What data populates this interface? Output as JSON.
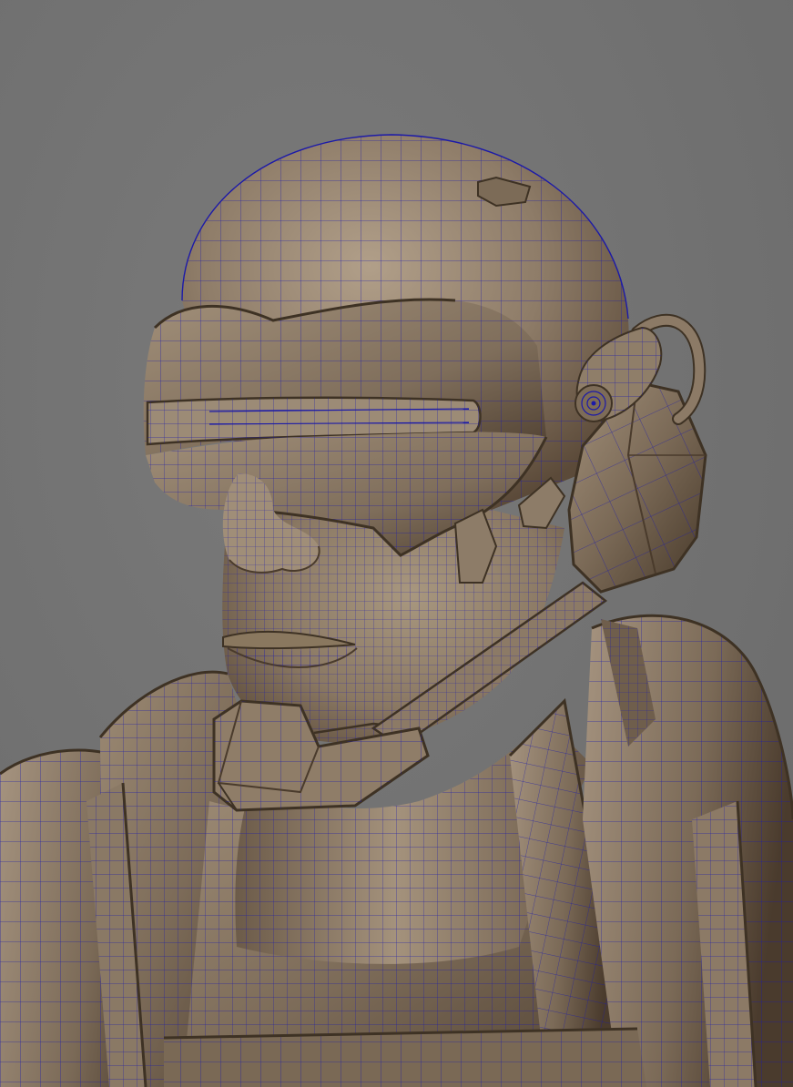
{
  "scene": {
    "kind": "3d-viewport-wireframe-on-shaded",
    "subject": "character-bust-helmet-visor-headset",
    "colors": {
      "background": "#737373",
      "surface_light": "#a59480",
      "surface_mid": "#8c7b67",
      "surface_dark": "#5a4a39",
      "surface_shadow": "#3e3224",
      "wireframe": "#1c1aa8"
    }
  }
}
